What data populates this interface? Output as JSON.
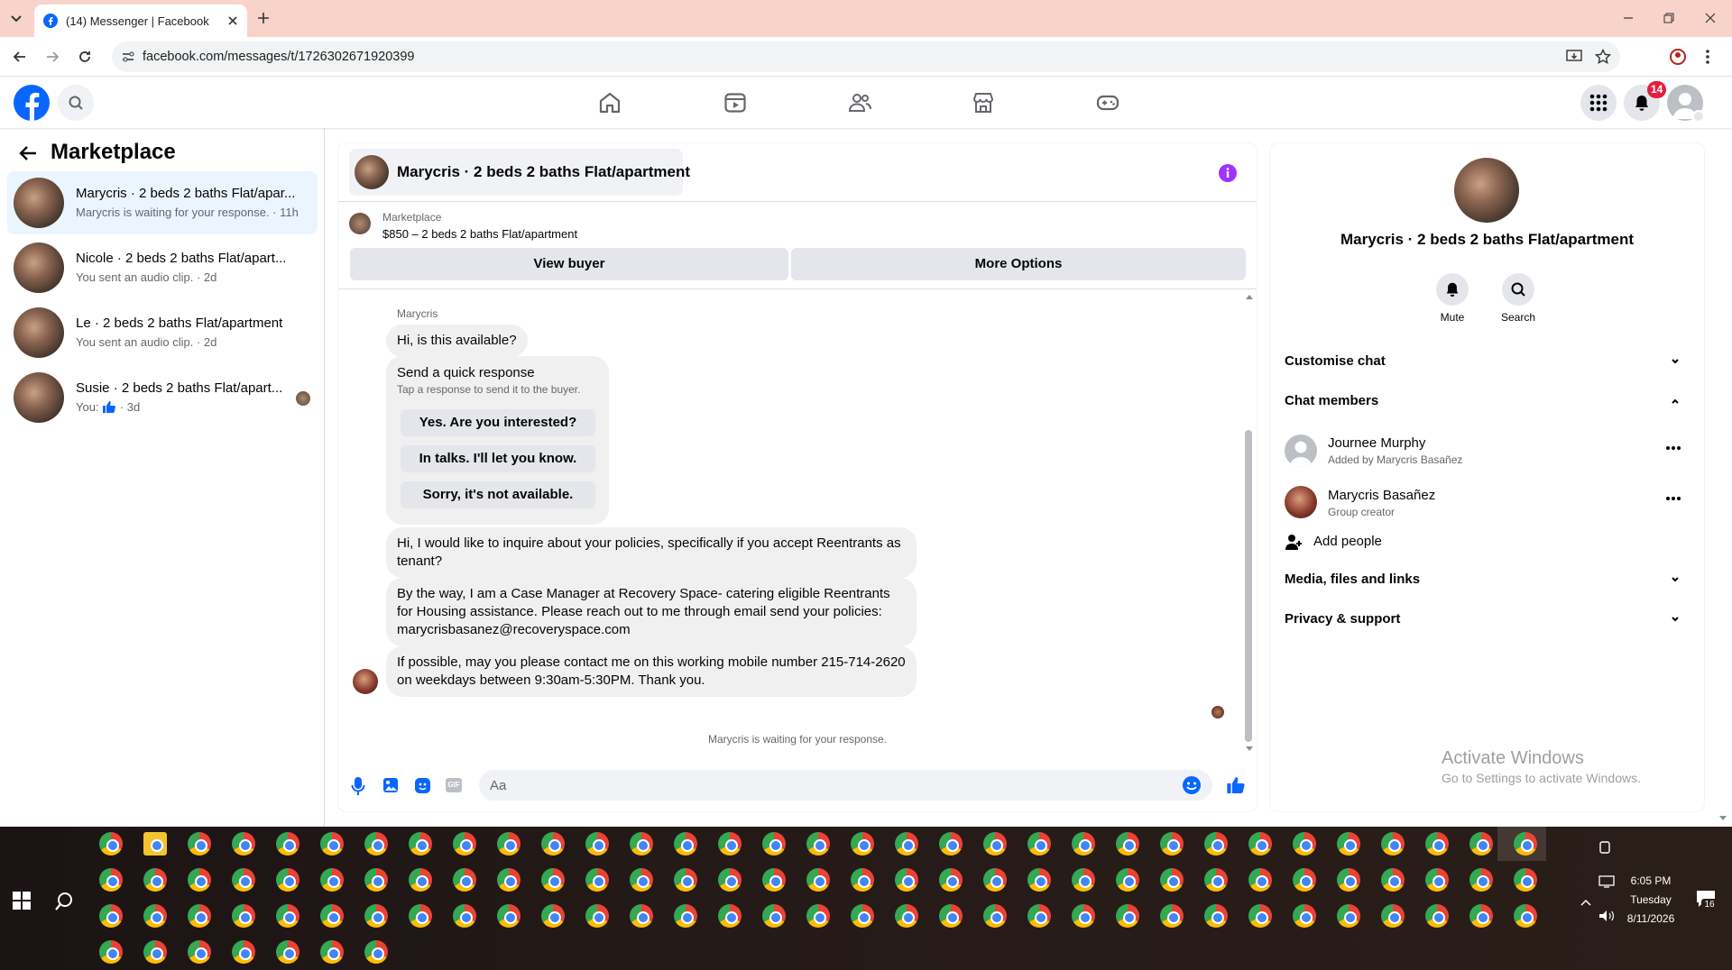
{
  "browser": {
    "tab_title": "(14) Messenger | Facebook",
    "url": "facebook.com/messages/t/1726302671920399"
  },
  "header": {
    "notifications_badge": "14",
    "nav_icons": [
      "home-icon",
      "video-icon",
      "friends-icon",
      "marketplace-icon",
      "gaming-icon"
    ]
  },
  "sidebar": {
    "title": "Marketplace",
    "conversations": [
      {
        "name": "Marycris · 2 beds 2 baths Flat/apar...",
        "preview": "Marycris is waiting for your response. · 11h"
      },
      {
        "name": "Nicole · 2 beds 2 baths Flat/apart...",
        "preview": "You sent an audio clip. · 2d"
      },
      {
        "name": "Le · 2 beds 2 baths Flat/apartment",
        "preview": "You sent an audio clip. · 2d"
      },
      {
        "name": "Susie · 2 beds 2 baths Flat/apart...",
        "preview_prefix": "You:",
        "preview_suffix": "· 3d"
      }
    ]
  },
  "chat": {
    "title": "Marycris · 2 beds 2 baths Flat/apartment",
    "listing_label": "Marketplace",
    "listing_title": "$850 – 2 beds 2 baths Flat/apartment",
    "view_buyer": "View buyer",
    "more_options": "More Options",
    "sender_name": "Marycris",
    "messages": [
      "Hi, is this available?",
      "Hi, I would like to inquire about your policies, specifically if you accept Reentrants as tenant?",
      "By the way, I am a Case Manager at Recovery Space- catering eligible Reentrants for Housing assistance. Please reach out to me through email send your policies: marycrisbasanez@recoveryspace.com",
      "If possible, may you please contact me on this working mobile number 215-714-2620 on weekdays between 9:30am-5:30PM. Thank you."
    ],
    "quick_response": {
      "title": "Send a quick response",
      "subtitle": "Tap a response to send it to the buyer.",
      "options": [
        "Yes. Are you interested?",
        "In talks. I'll let you know.",
        "Sorry, it's not available."
      ]
    },
    "status": "Marycris is waiting for your response.",
    "composer_placeholder": "Aa"
  },
  "details": {
    "name": "Marycris · 2 beds 2 baths Flat/apartment",
    "mute": "Mute",
    "search": "Search",
    "customise_chat": "Customise chat",
    "chat_members": "Chat members",
    "members": [
      {
        "name": "Journee Murphy",
        "sub": "Added by Marycris Basañez"
      },
      {
        "name": "Marycris Basañez",
        "sub": "Group creator"
      }
    ],
    "add_people": "Add people",
    "media": "Media, files and links",
    "privacy": "Privacy & support",
    "watermark_title": "Activate Windows",
    "watermark_sub": "Go to Settings to activate Windows."
  },
  "taskbar": {
    "time": "6:05 PM",
    "day": "Tuesday",
    "date": "8/11/2026",
    "notif_count": "16"
  },
  "colors": {
    "fb_blue": "#0866ff",
    "accent_purple": "#a033ff",
    "tab_strip": "#f8d3c9"
  }
}
